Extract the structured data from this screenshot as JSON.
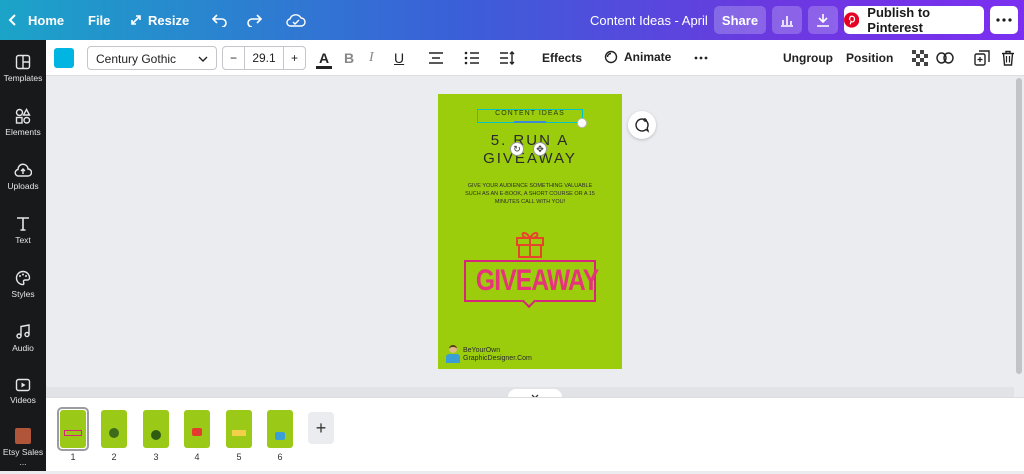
{
  "topbar": {
    "home": "Home",
    "file": "File",
    "resize": "Resize",
    "title": "Content Ideas - April",
    "share": "Share",
    "publish": "Publish to Pinterest"
  },
  "sidebar": {
    "items": [
      {
        "label": "Templates",
        "icon": "templates-icon"
      },
      {
        "label": "Elements",
        "icon": "elements-icon"
      },
      {
        "label": "Uploads",
        "icon": "uploads-icon"
      },
      {
        "label": "Text",
        "icon": "text-icon"
      },
      {
        "label": "Styles",
        "icon": "styles-icon"
      },
      {
        "label": "Audio",
        "icon": "audio-icon"
      },
      {
        "label": "Videos",
        "icon": "videos-icon"
      },
      {
        "label": "Etsy Sales ..."
      }
    ]
  },
  "toolbar": {
    "color": "#00b5e2",
    "font": "Century Gothic",
    "size": "29.1",
    "effects": "Effects",
    "animate": "Animate",
    "ungroup": "Ungroup",
    "position": "Position"
  },
  "design": {
    "tag": "CONTENT IDEAS",
    "heading_line1": "5. RUN A",
    "heading_line2": "GIVEAWAY",
    "body": "GIVE YOUR AUDIENCE SOMETHING VALUABLE SUCH AS AN E-BOOK, A SHORT COURSE OR A 15 MINUTES CALL WITH YOU!",
    "badge": "GIVEAWAY",
    "brand_line1": "BeYourOwn",
    "brand_line2": "GraphicDesigner.Com",
    "background": "#9bcd0d"
  },
  "pages": [
    "1",
    "2",
    "3",
    "4",
    "5",
    "6"
  ]
}
